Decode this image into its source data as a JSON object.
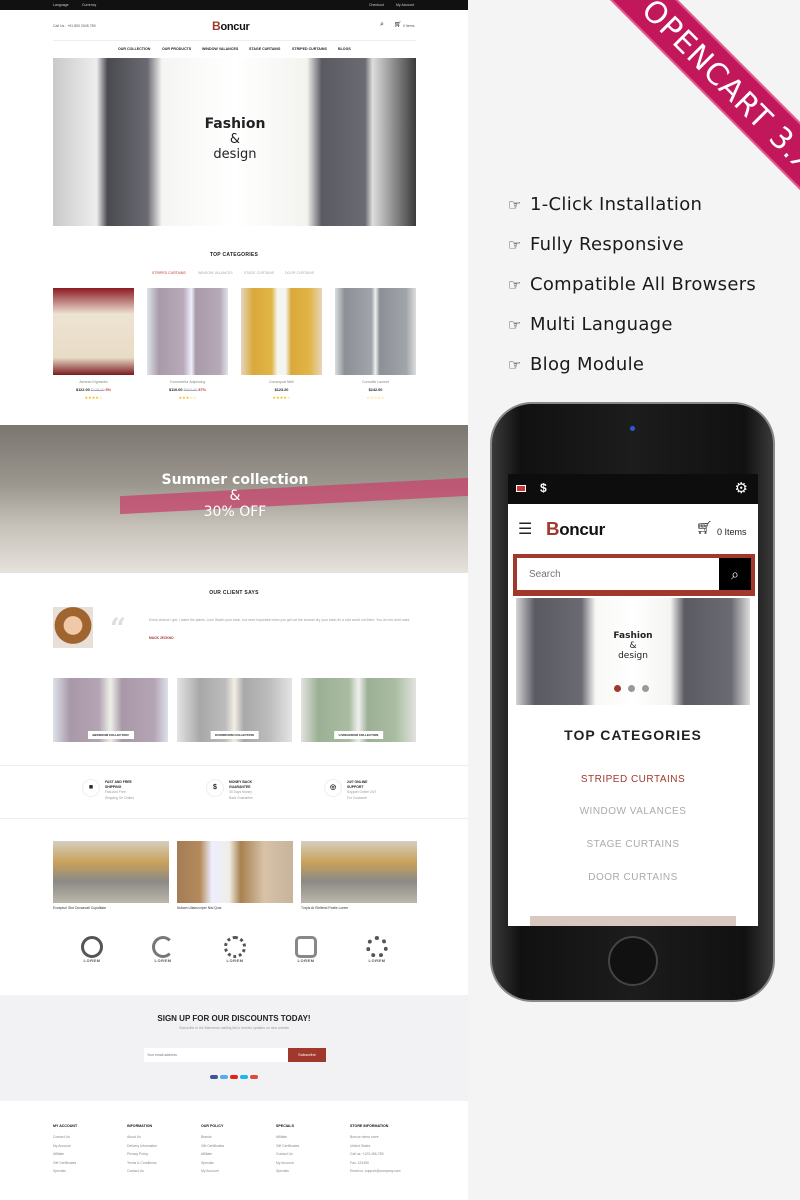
{
  "colors": {
    "accent": "#a0392b",
    "ribbon": "#c2185b",
    "topbar": "#111111",
    "star": "#f5b800"
  },
  "site": {
    "topbar": {
      "language": "Language",
      "currency": "Currency",
      "checkout": "Checkout",
      "account": "My Account"
    },
    "header": {
      "call": "Call Us : +91 800 2045 789",
      "logo": "Boncur",
      "cart": "0 Items"
    },
    "nav": [
      "OUR COLLECTION",
      "OUR PRODUCTS",
      "WINDOW VALANCES",
      "STAGE CURTAINS",
      "STRIPED CURTAINS",
      "BLOGS"
    ],
    "hero": {
      "line1": "Fashion",
      "amp": "&",
      "line2": "design"
    },
    "top_categories": {
      "title": "TOP CATEGORIES",
      "tabs": [
        "STRIPED CURTAINS",
        "WINDOW VALANCES",
        "STAGE CURTAINS",
        "DOOR CURTAINS"
      ],
      "products": [
        {
          "name": "Aenean Dignissim",
          "price": "$122.00",
          "old": "$128.00",
          "discount": "5%",
          "stars": "★★★★☆"
        },
        {
          "name": "Consectetur Adipiscing",
          "price": "$110.00",
          "old": "$842.00",
          "discount": "87%",
          "stars": "★★★☆☆"
        },
        {
          "name": "Consequat Nibh",
          "price": "$123.20",
          "old": "",
          "discount": "",
          "stars": "★★★★☆"
        },
        {
          "name": "Convallis Laoreet",
          "price": "$242.00",
          "old": "",
          "discount": "",
          "stars": "☆☆☆☆☆"
        }
      ]
    },
    "banner": {
      "line1": "Summer collection",
      "amp": "&",
      "line2": "30% OFF"
    },
    "testimonial": {
      "title": "OUR CLIENT SAYS",
      "quote": "Every chance I get, I water the plants. Lion! Watch your back, but more important when you get out the shower dry your back,it's a cold world out there. You do nes don't want",
      "name": "MACK JECKNO"
    },
    "collections": [
      "BEDROOM COLLECTION",
      "DOORROOM COLLECTION",
      "LIVINGROOM COLLECTION"
    ],
    "services": [
      {
        "icon": "truck-icon",
        "glyph": "■",
        "title1": "FAST AND FREE",
        "title2": "SHIPPING",
        "sub1": "Fast And Free",
        "sub2": "Shipping On Orders"
      },
      {
        "icon": "dollar-icon",
        "glyph": "$",
        "title1": "MONEY BACK",
        "title2": "GUARANTEE",
        "sub1": "30 Days Money",
        "sub2": "Back Guarantee"
      },
      {
        "icon": "support-icon",
        "glyph": "◎",
        "title1": "24/7 ONLINE",
        "title2": "SUPPORT",
        "sub1": "Support Online 24/7",
        "sub2": "For Customer"
      }
    ],
    "blogs": [
      "Excepturi Sint Occaecati Cupiditate",
      "Nullam Ullamcorper Nisl Quis",
      "Turpis At Eleifend Featis Lorem"
    ],
    "brands": [
      "LOREM",
      "LOREM",
      "LOREM",
      "LOREM",
      "LOREM"
    ],
    "newsletter": {
      "title": "SIGN UP FOR OUR DISCOUNTS TODAY!",
      "subtitle": "Subscribe to the Mannento mailing list to receive updates on new arrivals",
      "placeholder": "Your email address",
      "button": "Subscribe"
    },
    "footer": [
      {
        "title": "MY ACCOUNT",
        "items": [
          "Contact Us",
          "My Account",
          "Affiliate",
          "Gift Certificates",
          "Specials"
        ]
      },
      {
        "title": "INFORMATION",
        "items": [
          "About Us",
          "Delivery Information",
          "Privacy Policy",
          "Terms & Conditions",
          "Contact Us"
        ]
      },
      {
        "title": "OUR POLICY",
        "items": [
          "Brands",
          "Gift Certificates",
          "Affiliate",
          "Specials",
          "My Account"
        ]
      },
      {
        "title": "SPECIALS",
        "items": [
          "Affiliate",
          "Gift Certificates",
          "Contact Us",
          "My Account",
          "Specials"
        ]
      },
      {
        "title": "STORE INFORMATION",
        "items": [
          "Boncur demo store",
          "United States",
          "Call us: +123-456-789",
          "Fax: 123456",
          "Email us: support@company.com"
        ]
      }
    ]
  },
  "promo": {
    "ribbon": "OPENCART 3.X",
    "features": [
      "1-Click Installation",
      "Fully Responsive",
      "Compatible All Browsers",
      "Multi Language",
      "Blog Module"
    ]
  },
  "mobile": {
    "currency": "$",
    "logo": "Boncur",
    "cart": "0 Items",
    "search_placeholder": "Search",
    "hero": {
      "line1": "Fashion",
      "amp": "&",
      "line2": "design"
    },
    "slider_active": 1,
    "slider_count": 3,
    "categories_title": "TOP CATEGORIES",
    "categories": [
      "STRIPED CURTAINS",
      "WINDOW VALANCES",
      "STAGE CURTAINS",
      "DOOR CURTAINS"
    ]
  }
}
